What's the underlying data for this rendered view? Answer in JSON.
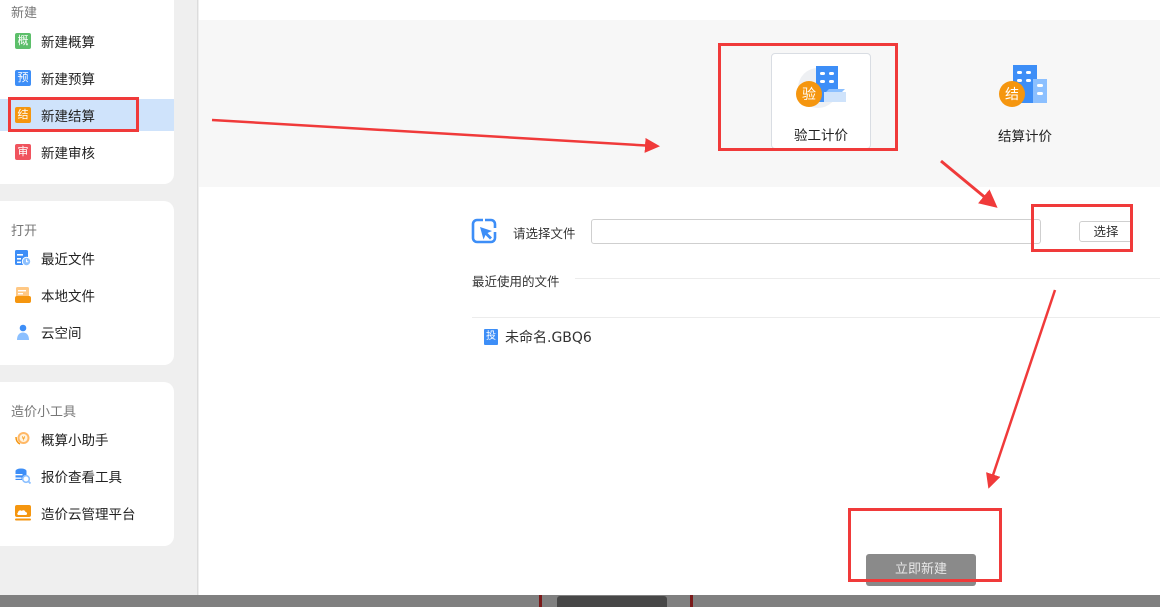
{
  "sidebar": {
    "new_section": {
      "title": "新建",
      "items": [
        {
          "label": "新建概算",
          "icon": "概",
          "icon_color": "#5cbf6a",
          "icon_name": "estimate-icon"
        },
        {
          "label": "新建预算",
          "icon": "预",
          "icon_color": "#3d8ef7",
          "icon_name": "budget-icon"
        },
        {
          "label": "新建结算",
          "icon": "结",
          "icon_color": "#f5960f",
          "icon_name": "settlement-icon",
          "active": true
        },
        {
          "label": "新建审核",
          "icon": "审",
          "icon_color": "#f0545e",
          "icon_name": "audit-icon"
        }
      ]
    },
    "open_section": {
      "title": "打开",
      "items": [
        {
          "label": "最近文件",
          "icon_name": "recent-files-icon"
        },
        {
          "label": "本地文件",
          "icon_name": "local-files-icon"
        },
        {
          "label": "云空间",
          "icon_name": "cloud-space-icon"
        }
      ]
    },
    "tools_section": {
      "title": "造价小工具",
      "items": [
        {
          "label": "概算小助手",
          "icon_name": "estimate-assistant-icon"
        },
        {
          "label": "报价查看工具",
          "icon_name": "quote-viewer-icon"
        },
        {
          "label": "造价云管理平台",
          "icon_name": "cloud-platform-icon"
        }
      ]
    }
  },
  "main": {
    "types": [
      {
        "label": "验工计价",
        "badge": "验",
        "selected": true
      },
      {
        "label": "结算计价",
        "badge": "结",
        "selected": false
      }
    ],
    "file_picker": {
      "label": "请选择文件",
      "value": "",
      "button": "选择"
    },
    "recent": {
      "title": "最近使用的文件",
      "files": [
        {
          "name": "未命名.GBQ6",
          "icon": "投"
        }
      ]
    },
    "create_button": "立即新建"
  },
  "colors": {
    "accent": "#3d8ef7",
    "selected_bg": "#cfe3fb",
    "annotation": "#f03a3a",
    "badge_orange": "#f5960f"
  }
}
